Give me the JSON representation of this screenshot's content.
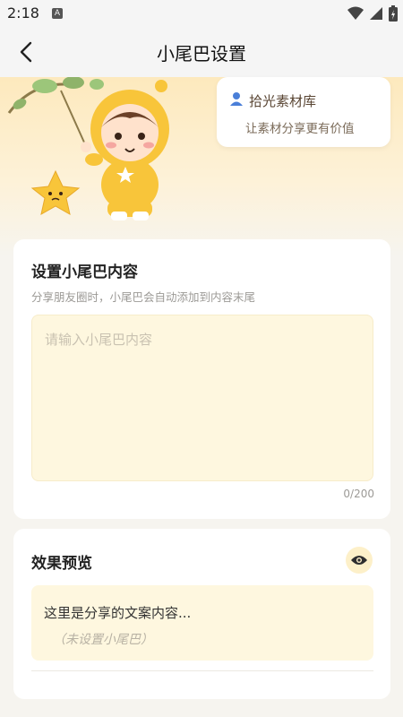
{
  "status_bar": {
    "time": "2:18",
    "notification_icon": "A"
  },
  "header": {
    "title": "小尾巴设置",
    "back_icon": "chevron-left-icon"
  },
  "brand": {
    "name": "拾光素材库",
    "slogan": "让素材分享更有价值"
  },
  "tail_settings": {
    "title": "设置小尾巴内容",
    "description": "分享朋友圈时，小尾巴会自动添加到内容末尾",
    "placeholder": "请输入小尾巴内容",
    "value": "",
    "counter": "0/200"
  },
  "preview": {
    "title": "效果预览",
    "content": "这里是分享的文案内容...",
    "tail": "（未设置小尾巴）"
  },
  "colors": {
    "accent": "#fde9bd",
    "input_bg": "#fef7df",
    "mascot": "#f8c53a"
  }
}
